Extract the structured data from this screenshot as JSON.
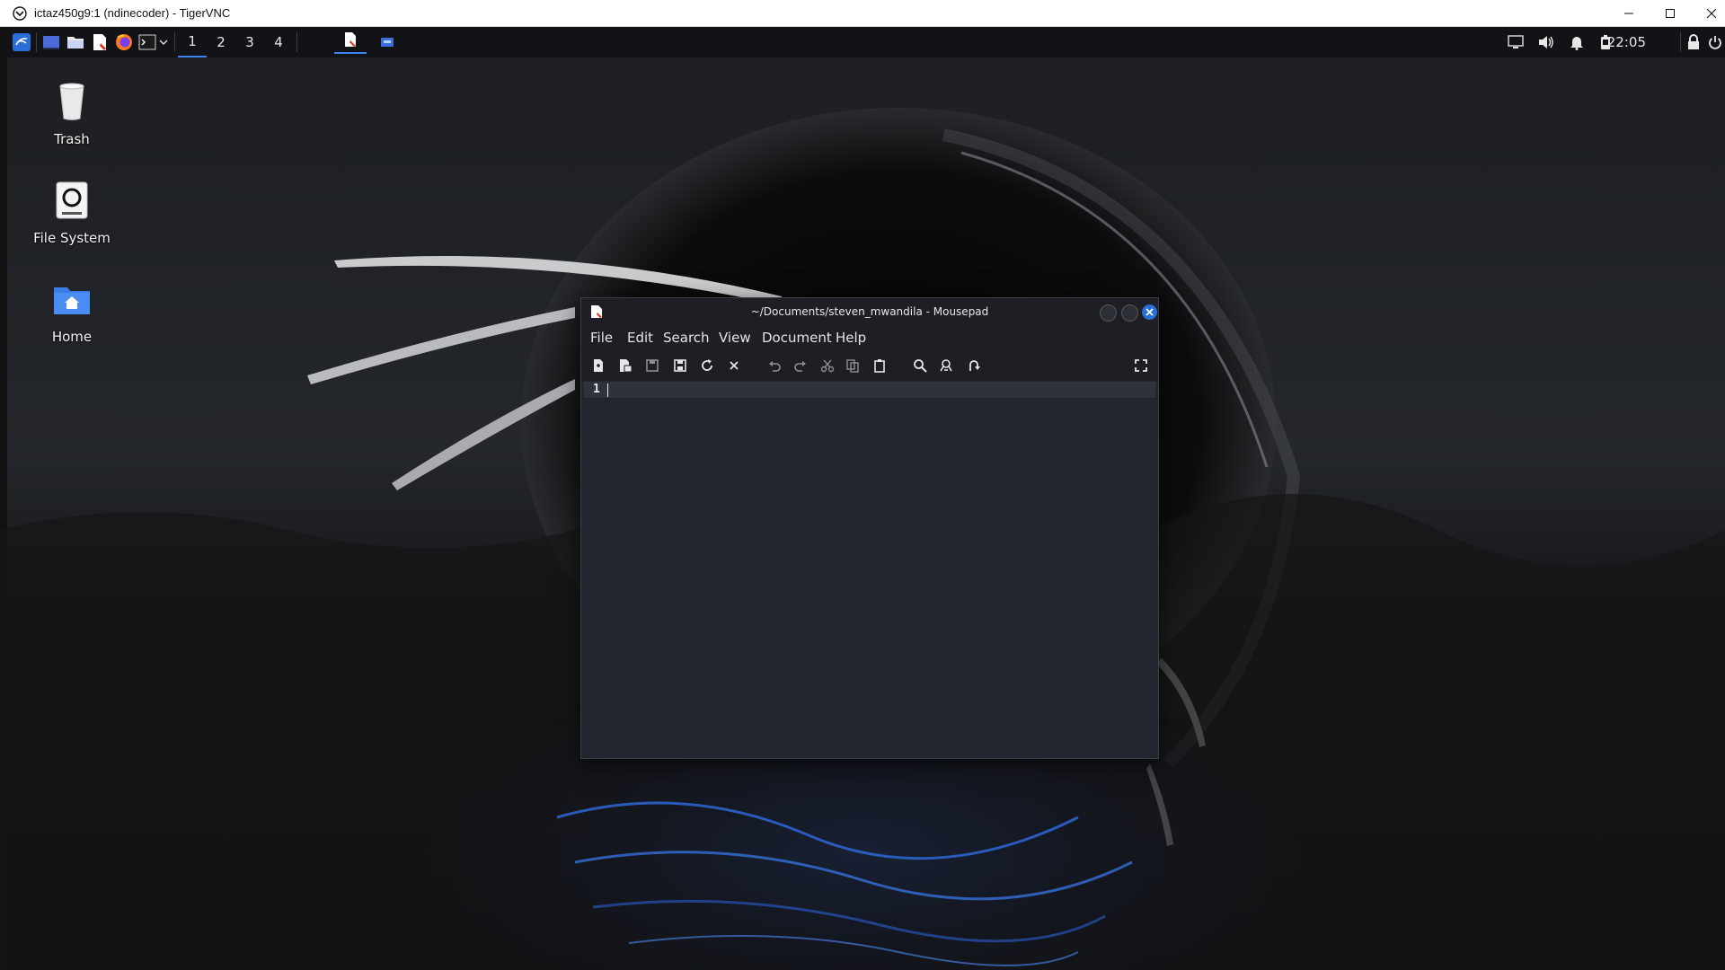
{
  "vnc_window": {
    "title": "ictaz450g9:1 (ndinecoder) - TigerVNC",
    "controls": [
      "minimize",
      "maximize",
      "close"
    ]
  },
  "panel": {
    "launchers": [
      "kali-menu-icon",
      "show-desktop-icon",
      "file-manager-icon",
      "text-editor-icon",
      "firefox-icon",
      "terminal-icon",
      "chevron-down-icon"
    ],
    "workspaces": [
      "1",
      "2",
      "3",
      "4"
    ],
    "active_workspace": "1",
    "tasks": [
      "mousepad-task-icon",
      "vnc-task-icon"
    ],
    "tray": [
      "display-icon",
      "volume-icon",
      "notification-bell-icon",
      "battery-icon"
    ],
    "clock": "22:05",
    "lock_icon": "lock-icon",
    "power_icon": "power-icon"
  },
  "desktop_icons": [
    {
      "label": "Trash",
      "icon": "trash-icon"
    },
    {
      "label": "File System",
      "icon": "drive-icon"
    },
    {
      "label": "Home",
      "icon": "home-folder-icon"
    }
  ],
  "mousepad": {
    "title": "~/Documents/steven_mwandila - Mousepad",
    "menu": [
      "File",
      "Edit",
      "Search",
      "View",
      "Document",
      "Help"
    ],
    "toolbar": [
      "new-document-icon",
      "new-window-icon",
      "save-icon",
      "save-as-icon",
      "reload-icon",
      "close-document-icon",
      "undo-icon",
      "redo-icon",
      "cut-icon",
      "copy-icon",
      "paste-icon",
      "find-icon",
      "find-replace-icon",
      "goto-icon",
      "fullscreen-icon"
    ],
    "line_number": "1",
    "content": ""
  },
  "colors": {
    "panel_bg": "#121316",
    "workspace_active": "#3a82f0",
    "editor_bg": "#23262e",
    "current_line": "#2e323b"
  }
}
